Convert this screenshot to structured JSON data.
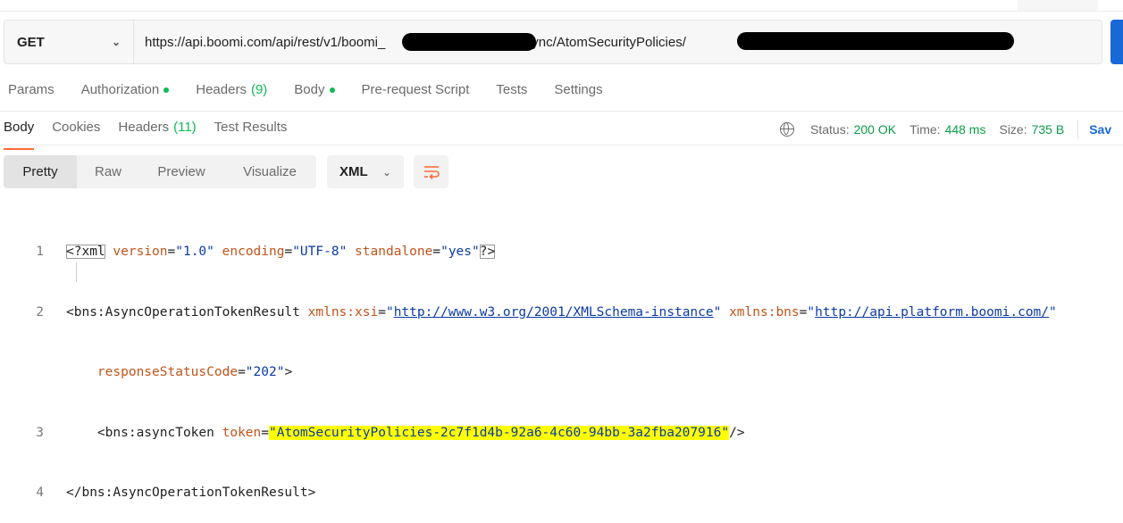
{
  "request": {
    "method": "GET",
    "url_visible": "https://api.boomi.com/api/rest/v1/boomi_",
    "url_middle": "/async/AtomSecurityPolicies/"
  },
  "request_tabs": [
    {
      "label": "Params"
    },
    {
      "label": "Authorization",
      "dot": true
    },
    {
      "label": "Headers",
      "count": "(9)"
    },
    {
      "label": "Body",
      "dot": true
    },
    {
      "label": "Pre-request Script"
    },
    {
      "label": "Tests"
    },
    {
      "label": "Settings"
    }
  ],
  "response_tabs": [
    {
      "label": "Body",
      "active": true
    },
    {
      "label": "Cookies"
    },
    {
      "label": "Headers",
      "count": "(11)"
    },
    {
      "label": "Test Results"
    }
  ],
  "status": {
    "status_label": "Status:",
    "status_value": "200 OK",
    "time_label": "Time:",
    "time_value": "448 ms",
    "size_label": "Size:",
    "size_value": "735 B",
    "save_label": "Sav"
  },
  "view_modes": [
    "Pretty",
    "Raw",
    "Preview",
    "Visualize"
  ],
  "format": "XML",
  "icons": {
    "globe": "globe-icon",
    "wrap": "wrap-lines-icon",
    "chevron": "chevron-down-icon"
  },
  "colors": {
    "accent": "#ff6c37",
    "ok": "#0a9e47",
    "highlight": "#ffff00"
  },
  "code": {
    "l1": {
      "n": "1"
    },
    "l2": {
      "n": "2"
    },
    "l3": {
      "n": "3"
    },
    "l4": {
      "n": "4"
    },
    "xml_decl_open": "<?xml",
    "attr_version": "version",
    "val_version": "\"1.0\"",
    "attr_encoding": "encoding",
    "val_encoding": "\"UTF-8\"",
    "attr_standalone": "standalone",
    "val_standalone": "\"yes\"",
    "xml_decl_close": "?>",
    "root_open": "<bns:AsyncOperationTokenResult",
    "attr_xsi": "xmlns:xsi",
    "val_xsi": "http://www.w3.org/2001/XMLSchema-instance",
    "attr_bns": "xmlns:bns",
    "val_bns": "http://api.platform.boomi.com/",
    "attr_status": "responseStatusCode",
    "val_status": "\"202\"",
    "child_open": "<bns:asyncToken",
    "attr_token": "token",
    "val_token": "AtomSecurityPolicies-2c7f1d4b-92a6-4c60-94bb-3a2fba207916",
    "child_close": "/>",
    "root_close": "</bns:AsyncOperationTokenResult>"
  }
}
